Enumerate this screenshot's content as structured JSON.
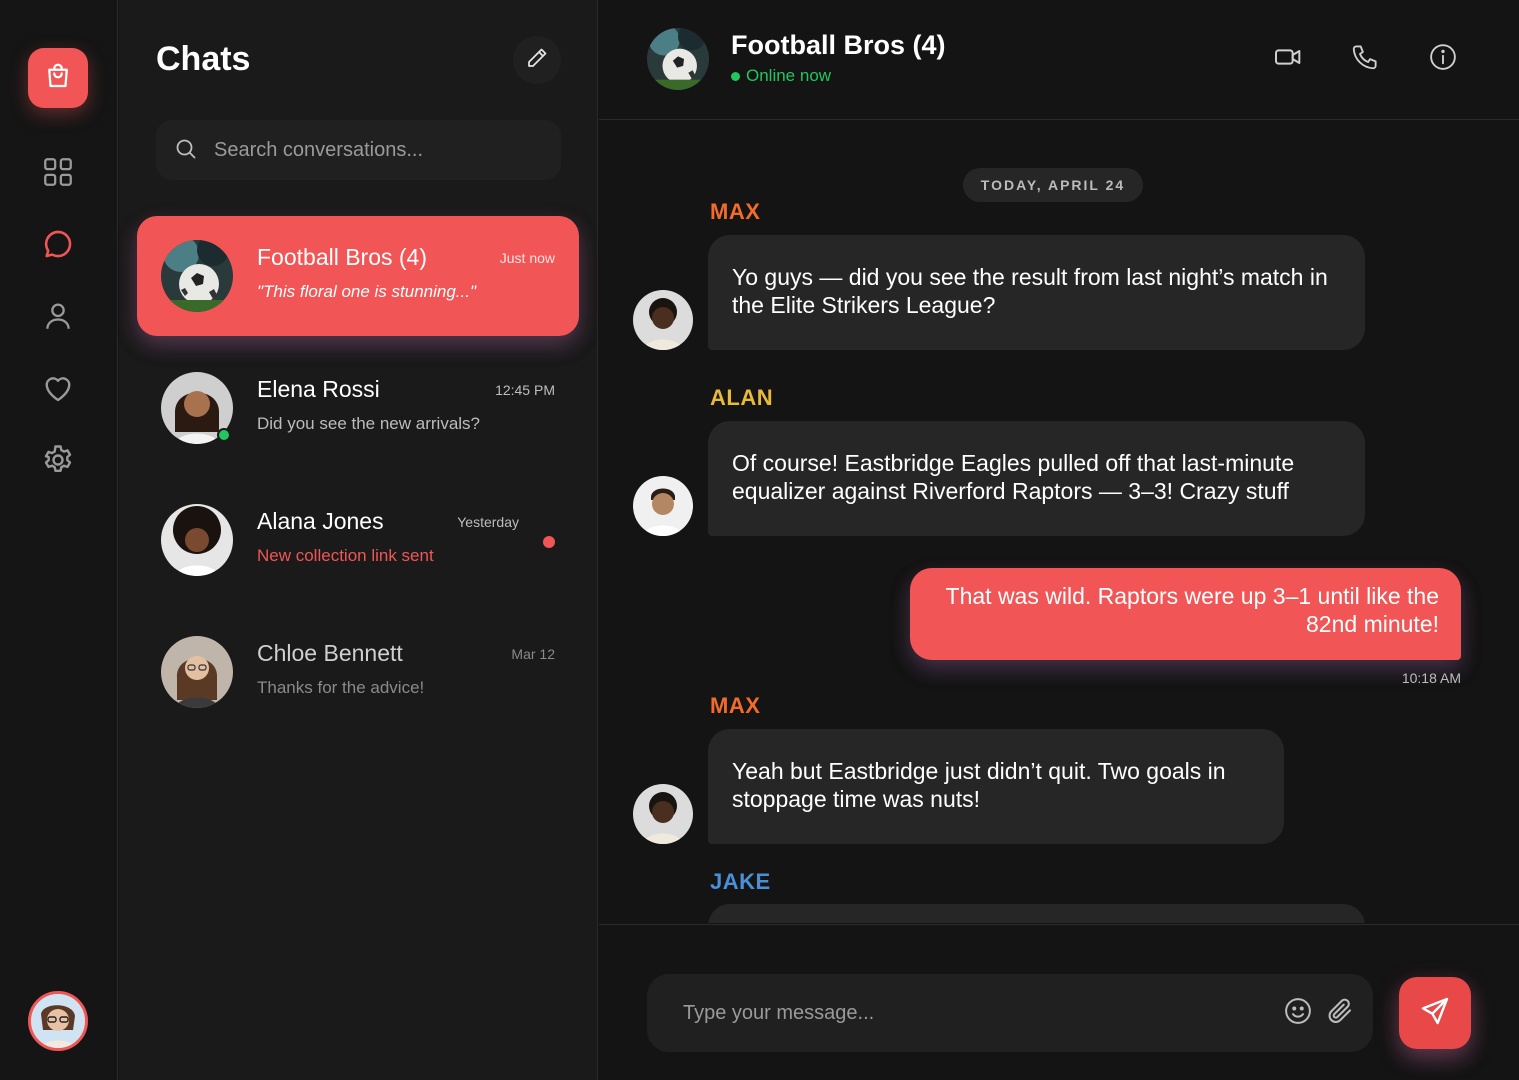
{
  "colors": {
    "accent": "#f25555",
    "online": "#22c55e",
    "max": "#f26b2a",
    "alan": "#e8b93a",
    "jake": "#4a90d9"
  },
  "list": {
    "title": "Chats",
    "search_placeholder": "Search conversations...",
    "conversations": [
      {
        "name": "Football Bros (4)",
        "time": "Just now",
        "preview": "\"This floral one is stunning...\"",
        "active": true
      },
      {
        "name": "Elena Rossi",
        "time": "12:45 PM",
        "preview": "Did you see the new arrivals?",
        "online": true
      },
      {
        "name": "Alana Jones",
        "time": "Yesterday",
        "preview": "New collection link sent",
        "unread": true
      },
      {
        "name": "Chloe Bennett",
        "time": "Mar 12",
        "preview": "Thanks for the advice!"
      }
    ]
  },
  "chat": {
    "title": "Football Bros (4)",
    "status": "Online now",
    "date_label": "TODAY, APRIL 24",
    "messages": [
      {
        "sender": "MAX",
        "text": "Yo guys — did you see the result from last night’s match in the Elite Strikers League?"
      },
      {
        "sender": "ALAN",
        "text": "Of course! Eastbridge Eagles pulled off that last-minute equalizer against Riverford Raptors — 3–3! Crazy stuff"
      },
      {
        "sender": "me",
        "text": "That was wild. Raptors were up 3–1 until like the 82nd minute!",
        "time": "10:18 AM"
      },
      {
        "sender": "MAX",
        "text": "Yeah but Eastbridge just didn’t quit. Two goals in stoppage time was nuts!"
      },
      {
        "sender": "JAKE",
        "text": ""
      }
    ],
    "composer_placeholder": "Type your message..."
  }
}
